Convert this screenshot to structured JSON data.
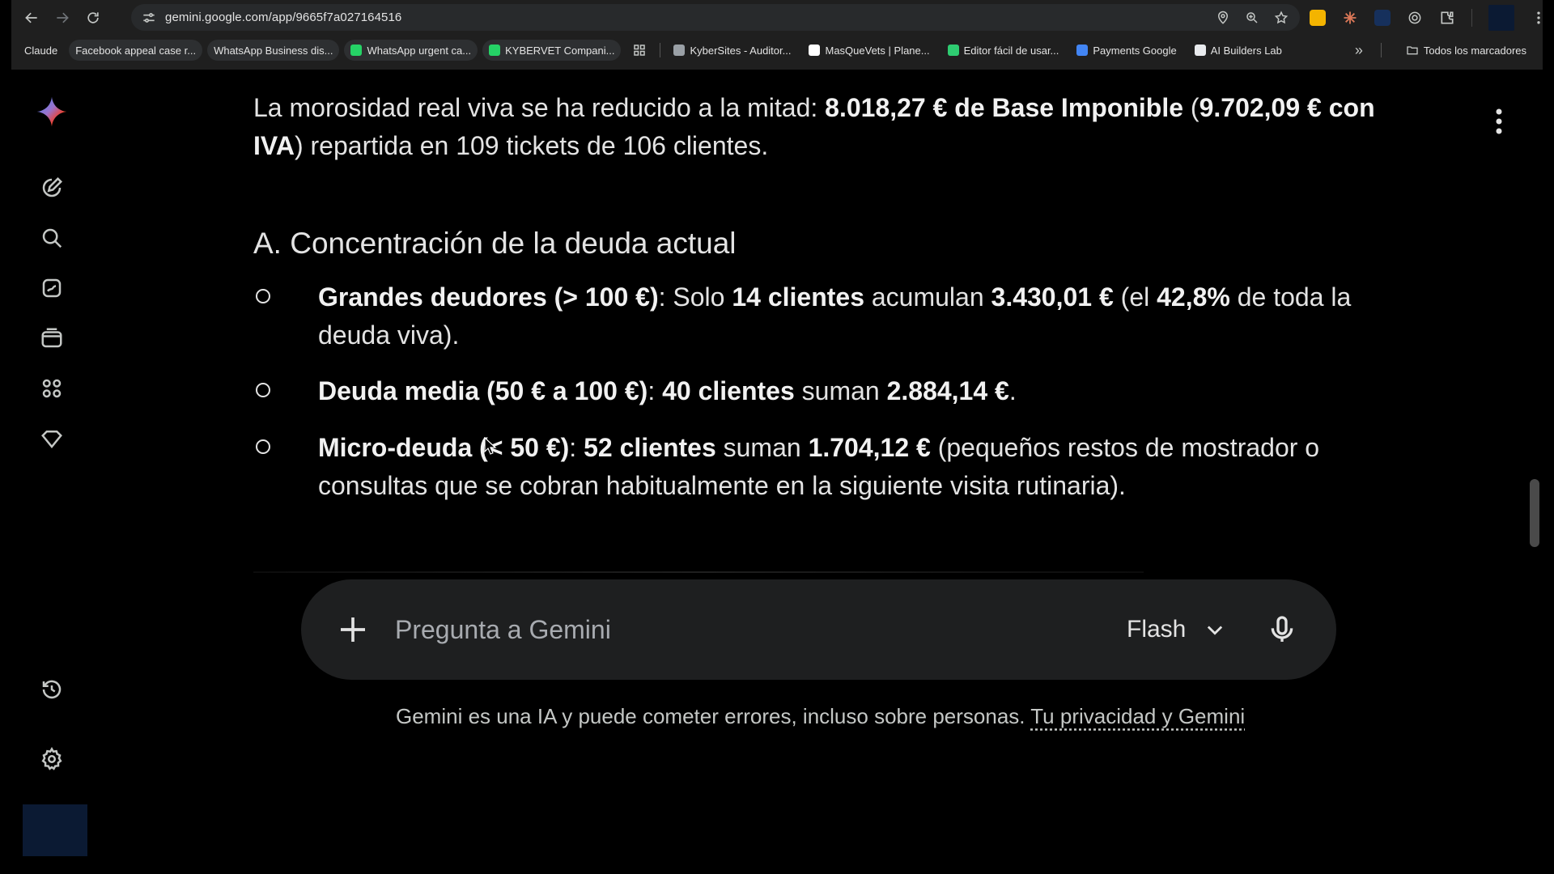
{
  "browser": {
    "url": "gemini.google.com/app/9665f7a027164516",
    "bookmarks": [
      {
        "label": "Claude",
        "color": "#d97757",
        "pill": false,
        "icon": false
      },
      {
        "label": "Facebook appeal case r...",
        "color": "#3b5998",
        "pill": true,
        "icon": false
      },
      {
        "label": "WhatsApp Business dis...",
        "color": "#25d366",
        "pill": true,
        "icon": false
      },
      {
        "label": "WhatsApp urgent ca...",
        "color": "#25d366",
        "pill": true,
        "icon": true
      },
      {
        "label": "KYBERVET Compani...",
        "color": "#25d366",
        "pill": true,
        "icon": true
      }
    ],
    "bookmarks_more": [
      {
        "label": "KyberSites - Auditor...",
        "color": "#9aa0a6"
      },
      {
        "label": "MasQueVets | Plane...",
        "color": "#ffffff"
      },
      {
        "label": "Editor fácil de usar...",
        "color": "#2ecc71"
      },
      {
        "label": "Payments Google",
        "color": "#4285f4"
      },
      {
        "label": "AI Builders Lab",
        "color": "#e8eaed"
      }
    ],
    "all_bookmarks": "Todos los marcadores",
    "overflow": "»"
  },
  "content": {
    "para": {
      "t1": "La morosidad real viva se ha reducido a la mitad: ",
      "b1": "8.018,27 € de Base Imponible",
      "t2": " (",
      "b2": "9.702,09 € con IVA",
      "t3": ") repartida en 109 tickets de 106 clientes."
    },
    "heading": "A. Concentración de la deuda actual",
    "items": [
      {
        "b1": "Grandes deudores (> 100 €)",
        "t1": ": Solo ",
        "b2": "14 clientes",
        "t2": " acumulan ",
        "b3": "3.430,01 €",
        "t3": " (el ",
        "b4": "42,8%",
        "t4": " de toda la deuda viva)."
      },
      {
        "b1": "Deuda media (50 € a 100 €)",
        "t1": ": ",
        "b2": "40 clientes",
        "t2": " suman ",
        "b3": "2.884,14 €",
        "t3": "."
      },
      {
        "b1": "Micro-deuda (< 50 €)",
        "t1": ": ",
        "b2": "52 clientes",
        "t2": " suman ",
        "b3": "1.704,12 €",
        "t3": " (pequeños restos de mostrador o consultas que se cobran habitualmente en la siguiente visita rutinaria)."
      }
    ]
  },
  "composer": {
    "placeholder": "Pregunta a Gemini",
    "model": "Flash"
  },
  "footer": {
    "disclaimer": "Gemini es una IA y puede cometer errores, incluso sobre personas. ",
    "link": "Tu privacidad y Gemini"
  },
  "colors": {
    "background": "#000000",
    "composer": "#1e1f20",
    "chrome": "#1f1f1f"
  }
}
